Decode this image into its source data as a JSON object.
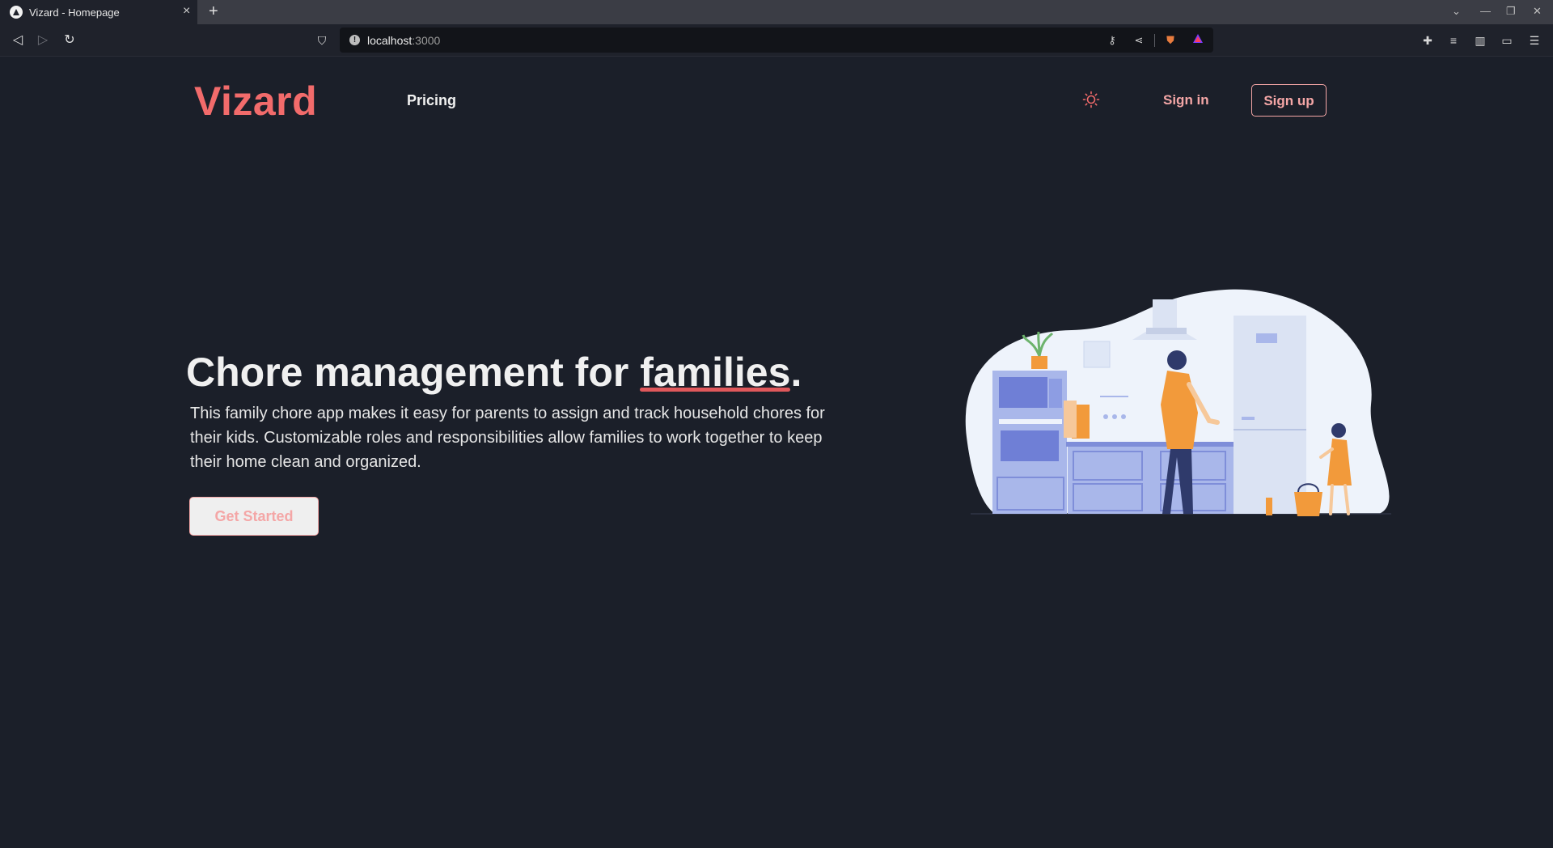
{
  "browser": {
    "tab_title": "Vizard - Homepage",
    "url_host": "localhost",
    "url_port": ":3000"
  },
  "header": {
    "logo": "Vizard",
    "nav_pricing": "Pricing",
    "sign_in": "Sign in",
    "sign_up": "Sign up"
  },
  "hero": {
    "headline_prefix": "Chore management for ",
    "headline_highlight": "families",
    "headline_suffix": ".",
    "subtitle": "This family chore app makes it easy for parents to assign and track household chores for their kids. Customizable roles and responsibilities allow families to work together to keep their home clean and organized.",
    "cta": "Get Started"
  },
  "colors": {
    "accent": "#f26b6b",
    "button_text": "#f4a6a6",
    "background": "#1b1f29",
    "highlight_underline": "#e0585b"
  }
}
